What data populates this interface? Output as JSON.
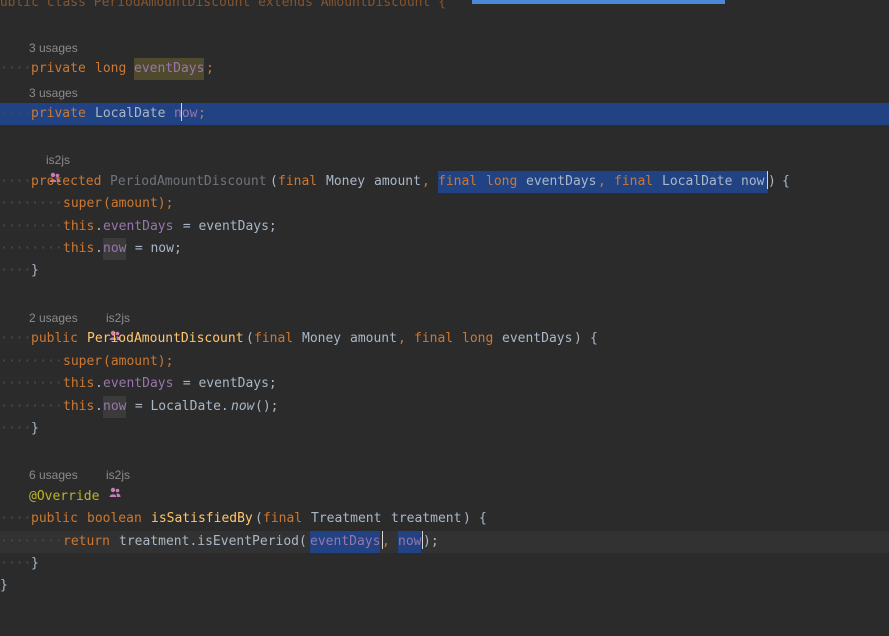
{
  "editor": {
    "colors": {
      "background": "#2b2b2b",
      "keyword": "#cc7832",
      "plain": "#a9b7c6",
      "field": "#9876aa",
      "method": "#ffc66d",
      "annotation": "#bbb529",
      "selection": "#214283",
      "hint": "#8b8b8b"
    },
    "top_fragment": "public class PeriodAmountDiscount extends AmountDiscount {",
    "hints": {
      "usages3a": "3 usages",
      "usages3b": "3 usages",
      "author_a": "is2js",
      "usages2": "2 usages",
      "author_b": "is2js",
      "usages6": "6 usages",
      "author_c": "is2js"
    },
    "tokens": {
      "private": "private",
      "long": "long",
      "eventDays": "eventDays",
      "semicolon": ";",
      "LocalDate": "LocalDate",
      "now": "now",
      "protected": "protected",
      "PeriodAmountDiscount": "PeriodAmountDiscount",
      "open_paren": "(",
      "final": "final",
      "Money": "Money",
      "amount": "amount",
      "comma": ",",
      "close_paren": ")",
      "open_brace": "{",
      "close_brace": "}",
      "super": "super",
      "super_args": "(amount);",
      "this": "this",
      "dot": ".",
      "assign_eventDays": " = eventDays;",
      "assign_now": " = now;",
      "assign_localdate": " = LocalDate.",
      "now_call": "now",
      "call_parens": "();",
      "public": "public",
      "override": "@Override",
      "boolean": "boolean",
      "isSatisfiedBy": "isSatisfiedBy",
      "Treatment": "Treatment",
      "treatment": "treatment",
      "return": "return",
      "treatment_call": "treatment.isEventPeriod(",
      "close_paren_semicolon": ");"
    }
  }
}
